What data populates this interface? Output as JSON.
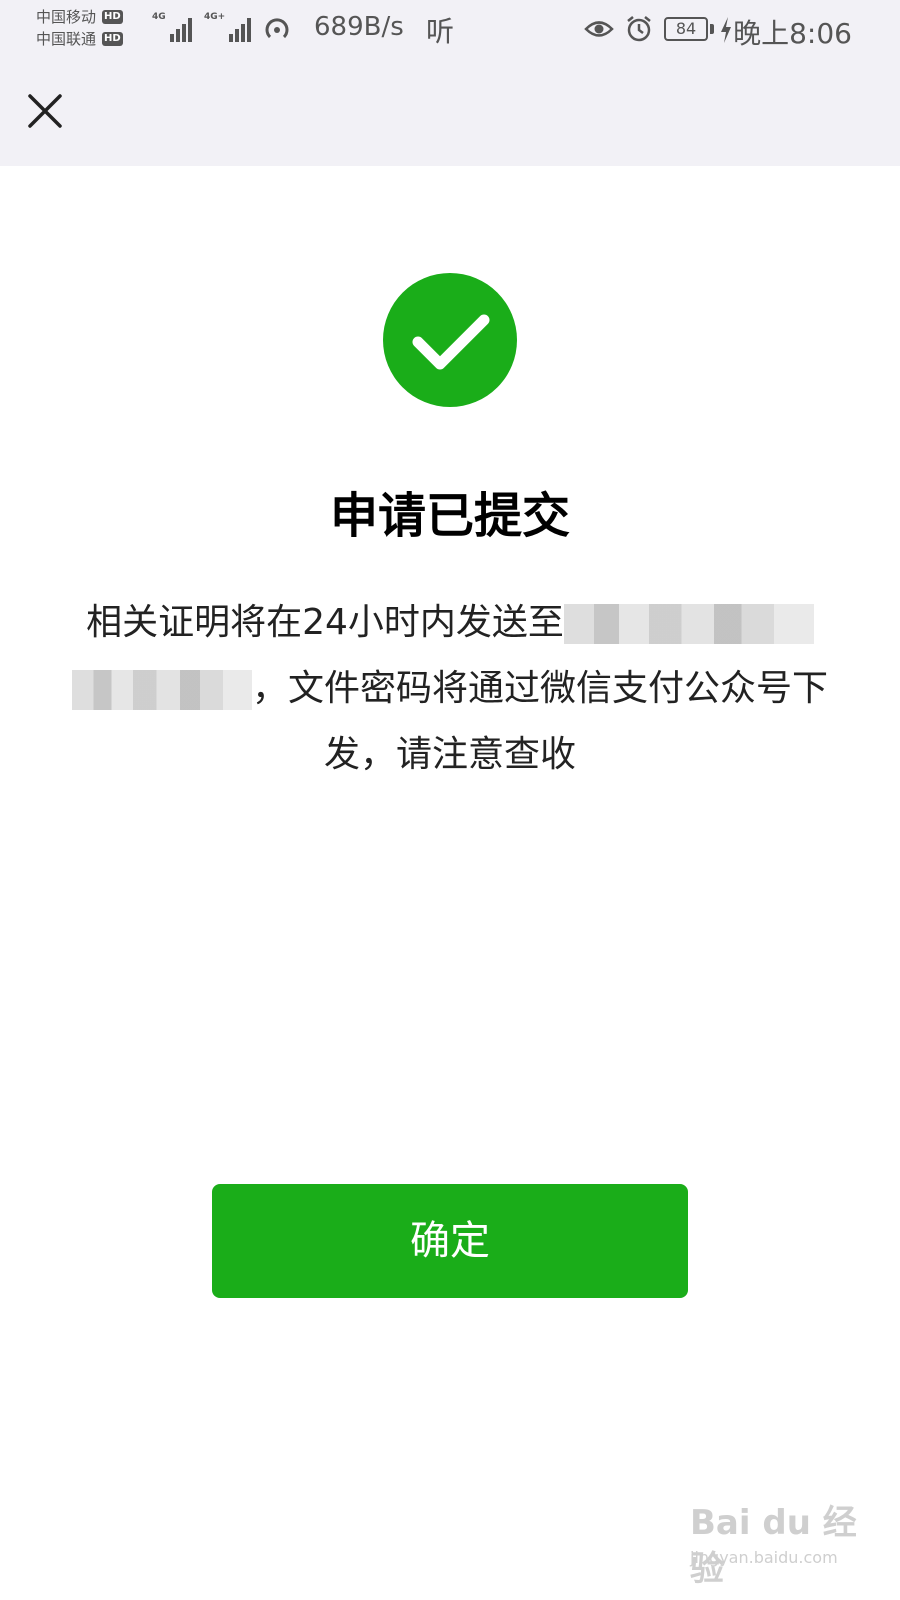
{
  "status_bar": {
    "carrier_1": "中国移动",
    "carrier_2": "中国联通",
    "hd_badge": "HD",
    "network_1": "4G",
    "network_2": "4G+",
    "net_speed": "689B/s",
    "listen_label": "听",
    "battery_level": "84",
    "time": "晚上8:06"
  },
  "nav": {
    "close_icon": "close-icon"
  },
  "content": {
    "success_icon": "check-circle-icon",
    "title": "申请已提交",
    "message_part1": "相关证明将在24小时内发送至",
    "message_part2": "，文件密码将通过微信支付公众号下发，请注意查收"
  },
  "actions": {
    "confirm_label": "确定"
  },
  "watermark": {
    "text": "Bai du 经验",
    "url": "jingyan.baidu.com"
  },
  "colors": {
    "accent_green": "#1aad19",
    "header_bg": "#f2f1f6"
  }
}
